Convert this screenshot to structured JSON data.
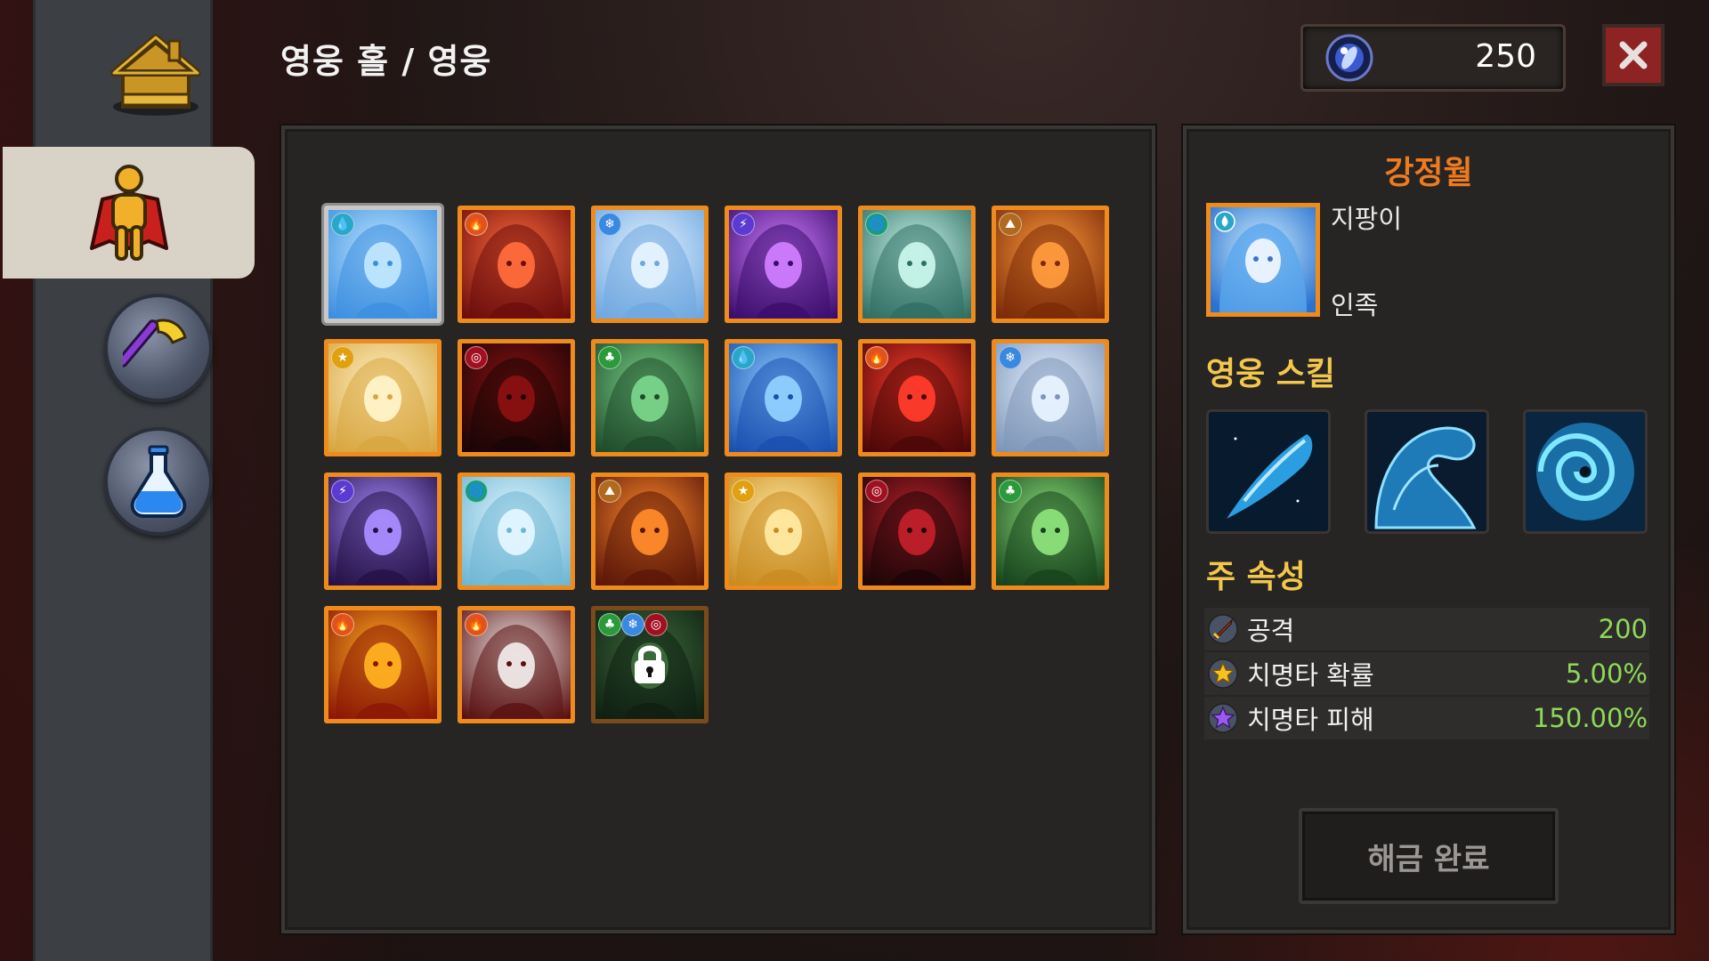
{
  "header": {
    "title": "영웅 홀 / 영웅",
    "currency_amount": "250",
    "close_icon": "close-icon"
  },
  "sidebar": {
    "items": [
      {
        "name": "home",
        "icon": "house-icon"
      },
      {
        "name": "heroes",
        "icon": "hero-icon",
        "selected": true
      },
      {
        "name": "equipment",
        "icon": "axe-icon"
      },
      {
        "name": "potions",
        "icon": "potion-icon"
      }
    ]
  },
  "heroes": [
    {
      "element": "water",
      "theme": [
        "#bfe6ff",
        "#3c8ee0"
      ],
      "selected": true
    },
    {
      "element": "fire",
      "theme": [
        "#ff6b3b",
        "#6b0d0d"
      ]
    },
    {
      "element": "ice",
      "theme": [
        "#e6f3ff",
        "#6fa7e0"
      ]
    },
    {
      "element": "lightning",
      "theme": [
        "#d07cff",
        "#3a0c6b"
      ]
    },
    {
      "element": "wind",
      "theme": [
        "#c9f5ea",
        "#2f6e62"
      ]
    },
    {
      "element": "earth",
      "theme": [
        "#ff9a3c",
        "#7a2a08"
      ]
    },
    {
      "element": "light",
      "theme": [
        "#fff3c9",
        "#d8a640"
      ]
    },
    {
      "element": "dark",
      "theme": [
        "#8a1010",
        "#1a0506"
      ]
    },
    {
      "element": "nature",
      "theme": [
        "#7ad48a",
        "#1f4a2a"
      ]
    },
    {
      "element": "water",
      "theme": [
        "#8fd0ff",
        "#1a4fb0"
      ]
    },
    {
      "element": "fire",
      "theme": [
        "#ff3b2b",
        "#4a0808"
      ]
    },
    {
      "element": "ice",
      "theme": [
        "#e8f2ff",
        "#7d95b8"
      ]
    },
    {
      "element": "lightning",
      "theme": [
        "#a98cff",
        "#241046"
      ]
    },
    {
      "element": "wind",
      "theme": [
        "#e2f6ff",
        "#6fb6d4"
      ]
    },
    {
      "element": "earth",
      "theme": [
        "#ff8a2b",
        "#5a1608"
      ]
    },
    {
      "element": "light",
      "theme": [
        "#ffe9a0",
        "#c98a20"
      ]
    },
    {
      "element": "dark",
      "theme": [
        "#c0202a",
        "#1c0508"
      ]
    },
    {
      "element": "nature",
      "theme": [
        "#8ce07a",
        "#16421c"
      ]
    },
    {
      "element": "fire",
      "theme": [
        "#ffb020",
        "#8a1604"
      ]
    },
    {
      "element": "fire",
      "theme": [
        "#f0e8e8",
        "#5a1010"
      ]
    },
    {
      "element": "multi",
      "theme": [
        "#3c6a3a",
        "#0f1f12"
      ],
      "locked": true,
      "extra_elements": [
        "nature",
        "ice",
        "dark"
      ]
    }
  ],
  "detail": {
    "name": "강정월",
    "title": "지팡이",
    "race": "인족",
    "skills_title": "영웅 스킬",
    "skills": [
      {
        "icon": "water-comet-icon"
      },
      {
        "icon": "water-wave-icon"
      },
      {
        "icon": "water-vortex-icon"
      }
    ],
    "attributes_title": "주 속성",
    "stats": [
      {
        "label": "공격",
        "value": "200",
        "icon": "sword-icon"
      },
      {
        "label": "치명타 확률",
        "value": "5.00%",
        "icon": "star-gold-icon"
      },
      {
        "label": "치명타 피해",
        "value": "150.00%",
        "icon": "star-purple-icon"
      }
    ],
    "button_label": "해금 완료"
  },
  "colors": {
    "accent": "#ef8a1c",
    "name": "#f07a1e",
    "section": "#f3c74b",
    "stat_value": "#8ed85a",
    "close": "#8e2323"
  }
}
